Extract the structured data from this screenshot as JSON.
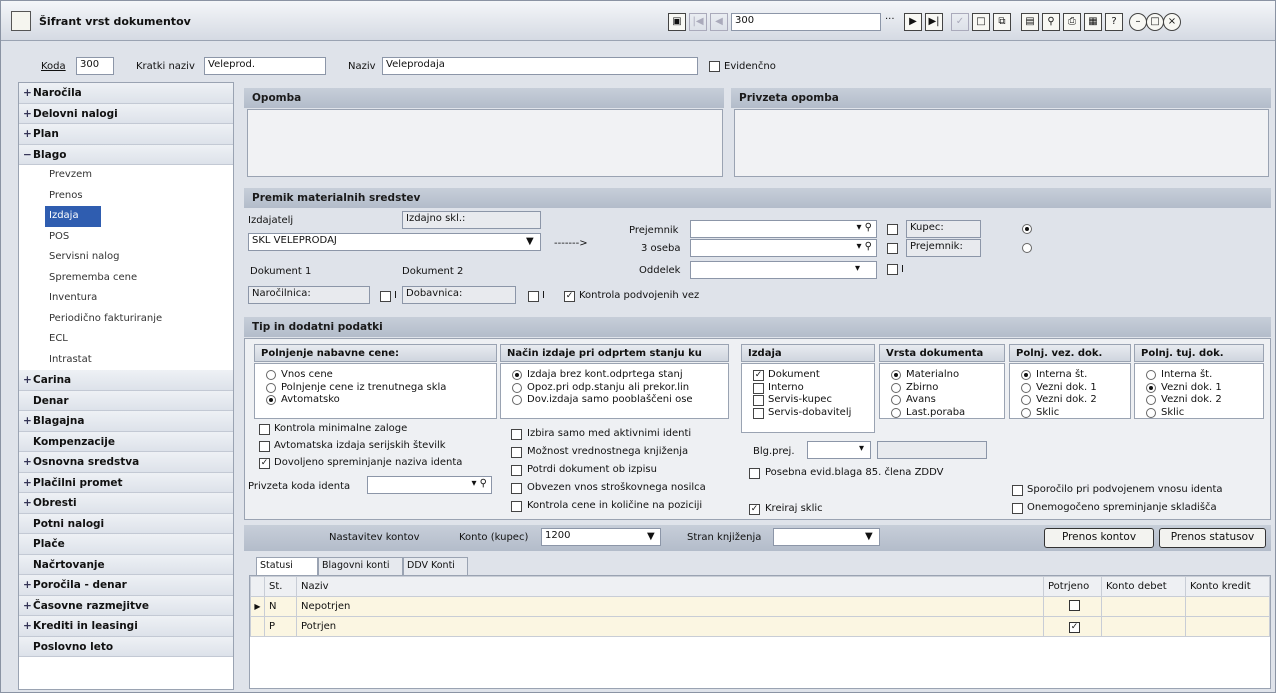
{
  "window": {
    "title": "Šifrant vrst dokumentov",
    "record_value": "300"
  },
  "top": {
    "koda_label": "Koda",
    "koda": "300",
    "kratki_label": "Kratki naziv",
    "kratki": "Veleprod.",
    "naziv_label": "Naziv",
    "naziv": "Veleprodaja",
    "evid_label": "Evidenčno"
  },
  "sidebar": [
    {
      "label": "Naročila",
      "sign": "+"
    },
    {
      "label": "Delovni nalogi",
      "sign": "+"
    },
    {
      "label": "Plan",
      "sign": "+"
    },
    {
      "label": "Blago",
      "sign": "−"
    },
    {
      "label": "Prevzem",
      "sub": true
    },
    {
      "label": "Prenos",
      "sub": true
    },
    {
      "label": "Izdaja",
      "sub": true,
      "selected": true
    },
    {
      "label": "POS",
      "sub": true
    },
    {
      "label": "Servisni nalog",
      "sub": true
    },
    {
      "label": "Sprememba cene",
      "sub": true
    },
    {
      "label": "Inventura",
      "sub": true
    },
    {
      "label": "Periodično fakturiranje",
      "sub": true
    },
    {
      "label": "ECL",
      "sub": true
    },
    {
      "label": "Intrastat",
      "sub": true
    },
    {
      "label": "Carina",
      "sign": "+"
    },
    {
      "label": "Denar",
      "sign": ""
    },
    {
      "label": "Blagajna",
      "sign": "+"
    },
    {
      "label": "Kompenzacije",
      "sign": ""
    },
    {
      "label": "Osnovna sredstva",
      "sign": "+"
    },
    {
      "label": "Plačilni promet",
      "sign": "+"
    },
    {
      "label": "Obresti",
      "sign": "+"
    },
    {
      "label": "Potni nalogi",
      "sign": ""
    },
    {
      "label": "Plače",
      "sign": ""
    },
    {
      "label": "Načrtovanje",
      "sign": ""
    },
    {
      "label": "Poročila - denar",
      "sign": "+"
    },
    {
      "label": "Časovne razmejitve",
      "sign": "+"
    },
    {
      "label": "Krediti in leasingi",
      "sign": "+"
    },
    {
      "label": "Poslovno leto",
      "sign": ""
    }
  ],
  "opomba": {
    "label": "Opomba",
    "privzeta_label": "Privzeta opomba"
  },
  "premik": {
    "title": "Premik materialnih sredstev",
    "izdajatelj": "Izdajatelj",
    "izdajno": "Izdajno skl.:",
    "skl": "SKL VELEPRODAJ",
    "arrow": "------->",
    "prejemnik": "Prejemnik",
    "oseba": "3 oseba",
    "oddelek": "Oddelek",
    "kupec": "Kupec:",
    "prejemnik2": "Prejemnik:",
    "i": "I",
    "dok1": "Dokument 1",
    "dok2": "Dokument 2",
    "dok1_val": "Naročilnica:",
    "dok2_val": "Dobavnica:",
    "kontrola": "Kontrola podvojenih vez"
  },
  "tip": {
    "title": "Tip in dodatni podatki",
    "polnjenje": {
      "title": "Polnjenje nabavne cene:",
      "opts": [
        "Vnos cene",
        "Polnjenje cene iz trenutnega skla",
        "Avtomatsko"
      ]
    },
    "nacin": {
      "title": "Način izdaje pri odprtem stanju ku",
      "opts": [
        "Izdaja brez kont.odprtega stanj",
        "Opoz.pri odp.stanju ali prekor.lin",
        "Dov.izdaja samo pooblaščeni ose"
      ]
    },
    "izdaja": {
      "title": "Izdaja",
      "opts": [
        "Dokument",
        "Interno",
        "Servis-kupec",
        "Servis-dobavitelj"
      ]
    },
    "vrsta": {
      "title": "Vrsta dokumenta",
      "opts": [
        "Materialno",
        "Zbirno",
        "Avans",
        "Last.poraba"
      ]
    },
    "polnvez": {
      "title": "Polnj. vez. dok.",
      "opts": [
        "Interna št.",
        "Vezni dok. 1",
        "Vezni dok. 2",
        "Sklic"
      ]
    },
    "polntuj": {
      "title": "Polnj. tuj. dok.",
      "opts": [
        "Interna št.",
        "Vezni dok. 1",
        "Vezni dok. 2",
        "Sklic"
      ]
    },
    "left_checks": [
      "Kontrola minimalne zaloge",
      "Avtomatska izdaja serijskih številk",
      "Dovoljeno spreminjanje naziva identa"
    ],
    "privzeta_koda": "Privzeta koda identa",
    "mid_checks": [
      "Izbira samo med aktivnimi identi",
      "Možnost vrednostnega knjiženja",
      "Potrdi dokument ob izpisu",
      "Obvezen vnos stroškovnega nosilca",
      "Kontrola cene in količine na poziciji"
    ],
    "blg_prej": "Blg.prej.",
    "posebna": "Posebna evid.blaga 85. člena ZDDV",
    "kreiraj": "Kreiraj sklic",
    "right_checks": [
      "Sporočilo pri podvojenem vnosu identa",
      "Onemogočeno spreminjanje skladišča"
    ]
  },
  "konti": {
    "nastavitev": "Nastavitev kontov",
    "konto_label": "Konto (kupec)",
    "konto": "1200",
    "stran": "Stran knjiženja",
    "prenos_kontov": "Prenos kontov",
    "prenos_statusov": "Prenos statusov"
  },
  "tabs": [
    "Statusi",
    "Blagovni konti",
    "DDV Konti"
  ],
  "grid": {
    "cols": [
      "St.",
      "Naziv",
      "Potrjeno",
      "Konto debet",
      "Konto kredit"
    ],
    "rows": [
      {
        "st": "N",
        "naziv": "Nepotrjen",
        "potrjeno": false
      },
      {
        "st": "P",
        "naziv": "Potrjen",
        "potrjeno": true
      }
    ]
  }
}
